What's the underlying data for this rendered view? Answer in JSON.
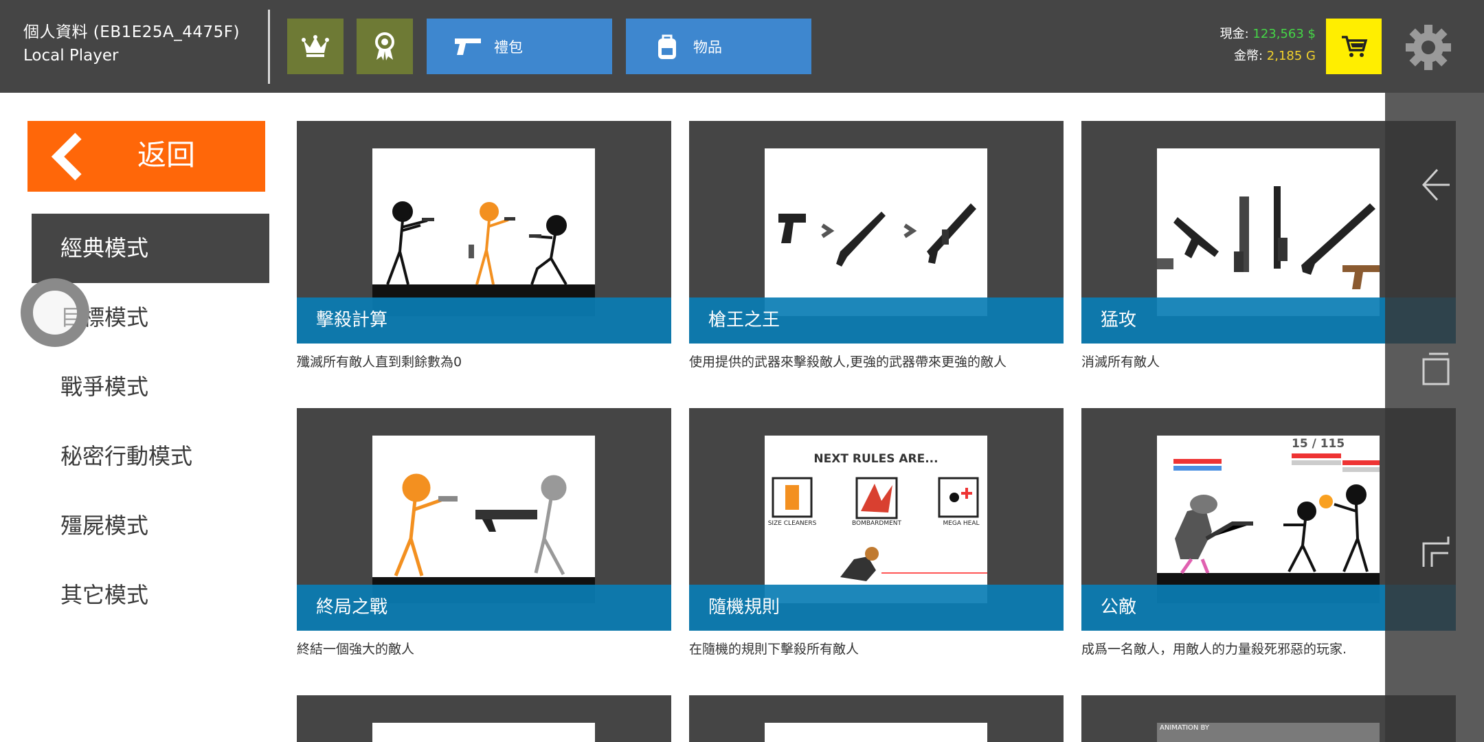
{
  "header": {
    "profile_label": "個人資料 (EB1E25A_4475F)",
    "player_name": "Local Player",
    "buttons": [
      {
        "label": "禮包",
        "icon": "pistol-icon"
      },
      {
        "label": "物品",
        "icon": "backpack-icon"
      }
    ],
    "cash_label": "現金:",
    "cash_value": "123,563 $",
    "gold_label": "金幣:",
    "gold_value": "2,185 G",
    "colors": {
      "cash": "#45d646",
      "gold": "#f2d22c",
      "cart": "#ffee00",
      "accent_square": "#6e7a35",
      "blue_button": "#3e87cf"
    }
  },
  "sidebar": {
    "back_label": "返回",
    "items": [
      {
        "label": "經典模式",
        "active": true
      },
      {
        "label": "目標模式",
        "active": false
      },
      {
        "label": "戰爭模式",
        "active": false
      },
      {
        "label": "秘密行動模式",
        "active": false
      },
      {
        "label": "殭屍模式",
        "active": false
      },
      {
        "label": "其它模式",
        "active": false
      }
    ]
  },
  "cards": [
    {
      "title": "擊殺計算",
      "desc": "殲滅所有敵人直到剩餘數為0"
    },
    {
      "title": "槍王之王",
      "desc": "使用提供的武器來擊殺敵人,更強的武器帶來更強的敵人"
    },
    {
      "title": "猛攻",
      "desc": "消滅所有敵人"
    },
    {
      "title": "終局之戰",
      "desc": "終結一個強大的敵人"
    },
    {
      "title": "隨機規則",
      "desc": "在隨機的規則下擊殺所有敵人",
      "image_text": "NEXT RULES ARE...",
      "rules": [
        "SIZE CLEANERS",
        "BOMBARDMENT",
        "MEGA HEAL"
      ]
    },
    {
      "title": "公敵",
      "desc": "成爲一名敵人，用敵人的力量殺死邪惡的玩家.",
      "image_text": "15 / 115"
    },
    {
      "title": "",
      "desc": ""
    },
    {
      "title": "",
      "desc": ""
    },
    {
      "title": "",
      "desc": "",
      "image_text": "ANIMATION BY"
    }
  ]
}
